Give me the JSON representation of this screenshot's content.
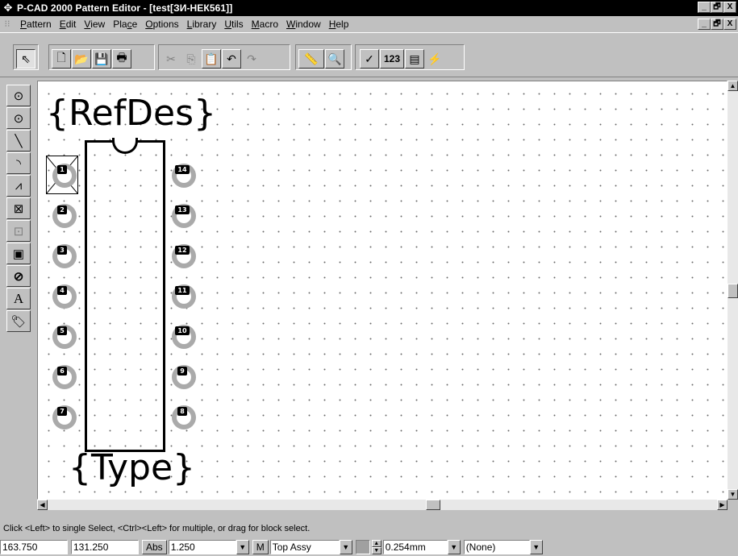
{
  "window": {
    "title": "P-CAD 2000 Pattern Editor - [test[ЗИ-НЕК561]]",
    "buttons": [
      "_",
      "🗗",
      "X"
    ]
  },
  "menu": {
    "items": [
      {
        "label": "Pattern"
      },
      {
        "label": "Edit"
      },
      {
        "label": "View"
      },
      {
        "label": "Place"
      },
      {
        "label": "Options"
      },
      {
        "label": "Library"
      },
      {
        "label": "Utils"
      },
      {
        "label": "Macro"
      },
      {
        "label": "Window"
      },
      {
        "label": "Help"
      }
    ]
  },
  "toolbar": {
    "select_icon": "arrow-cursor-icon",
    "new_icon": "new-file-icon",
    "open_icon": "open-folder-icon",
    "save_icon": "floppy-disk-icon",
    "print_icon": "printer-icon",
    "cut_icon": "scissors-icon",
    "copy_icon": "copy-icon",
    "paste_icon": "paste-icon",
    "undo_icon": "undo-icon",
    "redo_icon": "redo-icon",
    "measure_icon": "ruler-icon",
    "zoom_icon": "magnifier-icon",
    "check_icon": "checkmark-icon",
    "renumber_label": "123",
    "wizard_icon": "pattern-wizard-icon",
    "lightning_icon": "lightning-icon"
  },
  "left_tools": [
    "place-pad-icon",
    "place-via-icon",
    "place-line-icon",
    "place-arc-icon",
    "place-polygon-icon",
    "place-point-icon",
    "place-copper-pour-icon",
    "place-cutout-icon",
    "keepout-icon",
    "place-text-icon",
    "place-attribute-icon"
  ],
  "pattern": {
    "refdes_text": "{RefDes}",
    "type_text": "{Type}",
    "left_pins": [
      "1",
      "2",
      "3",
      "4",
      "5",
      "6",
      "7"
    ],
    "right_pins": [
      "14",
      "13",
      "12",
      "11",
      "10",
      "9",
      "8"
    ]
  },
  "hint_text": "Click <Left> to single Select, <Ctrl><Left> for multiple, or drag for block select.",
  "status": {
    "x_coord": "163.750",
    "y_coord": "131.250",
    "abs_label": "Abs",
    "grid_value": "1.250",
    "m_label": "M",
    "layer_value": "Top Assy",
    "line_width": "0.254mm",
    "style_value": "(None)"
  }
}
